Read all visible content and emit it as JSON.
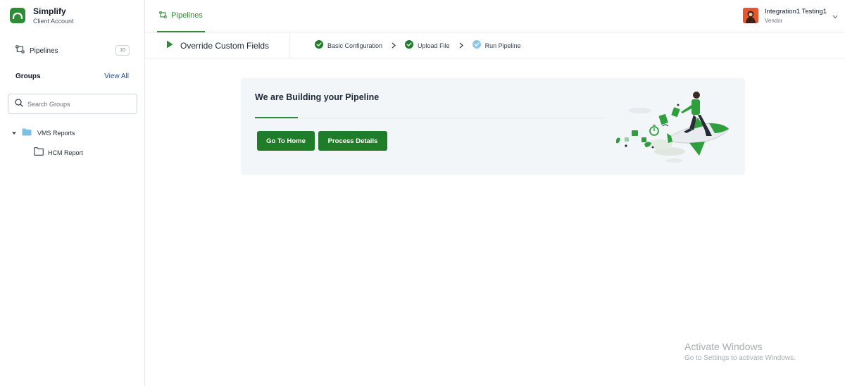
{
  "brand": {
    "name": "Simplify",
    "subtitle": "Client Account",
    "icon": "cloud-logo-icon",
    "color": "#2e8b36"
  },
  "sidebar": {
    "pipelines": {
      "label": "Pipelines",
      "count": "10",
      "icon": "pipeline-icon"
    },
    "groups": {
      "title": "Groups",
      "view_all": "View All"
    },
    "search": {
      "placeholder": "Search Groups",
      "value": "",
      "icon": "search-icon"
    },
    "tree": [
      {
        "label": "VMS Reports",
        "expanded": true,
        "icon": "folder-filled-icon"
      },
      {
        "label": "HCM Report",
        "icon": "folder-outline-icon"
      }
    ]
  },
  "header": {
    "tab": {
      "label": "Pipelines",
      "icon": "pipeline-icon",
      "active": true
    },
    "user": {
      "name": "Integration1 Testing1",
      "role": "Vendor",
      "icon": "avatar"
    }
  },
  "stepbar": {
    "title": "Override Custom Fields",
    "steps": [
      {
        "label": "Basic Configuration",
        "state": "complete"
      },
      {
        "label": "Upload File",
        "state": "complete"
      },
      {
        "label": "Run Pipeline",
        "state": "in-progress"
      }
    ]
  },
  "card": {
    "title": "We are Building your Pipeline",
    "buttons": {
      "home": "Go To Home",
      "details": "Process Details"
    },
    "illustration": "rocket-man-illustration"
  },
  "watermark": {
    "title": "Activate Windows",
    "subtitle": "Go to Settings to activate Windows."
  },
  "colors": {
    "accent": "#2e8b36",
    "button": "#1f7d2a",
    "link": "#1e4fa3",
    "card_bg": "#f3f6f9",
    "step_pending": "#8ec7e6"
  }
}
